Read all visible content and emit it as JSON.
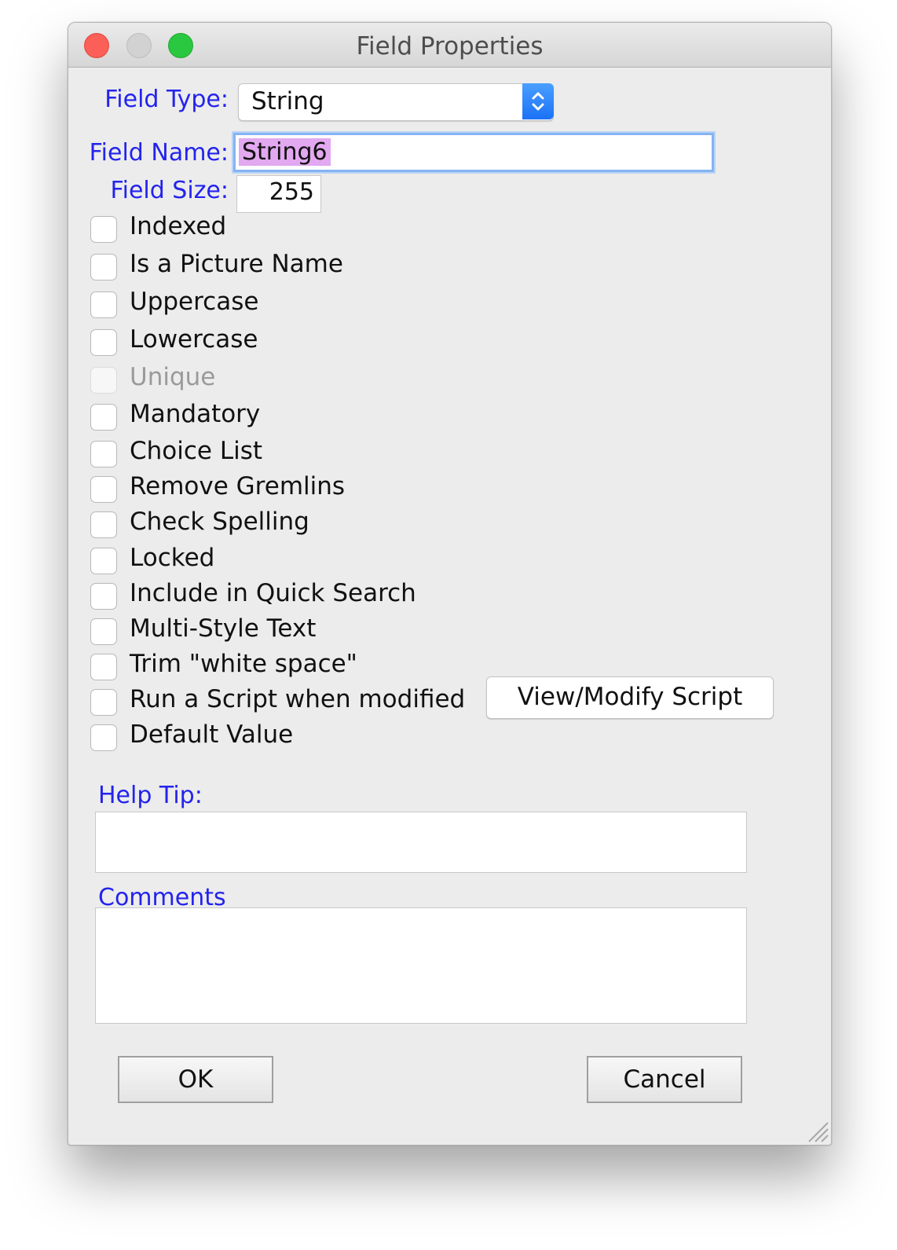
{
  "window": {
    "title": "Field Properties"
  },
  "field_type": {
    "label": "Field Type:",
    "value": "String"
  },
  "field_name": {
    "label": "Field Name:",
    "value": "String6"
  },
  "field_size": {
    "label": "Field Size:",
    "value": "255"
  },
  "options": [
    {
      "label": "Indexed",
      "checked": false,
      "enabled": true
    },
    {
      "label": "Is a Picture Name",
      "checked": false,
      "enabled": true
    },
    {
      "label": "Uppercase",
      "checked": false,
      "enabled": true
    },
    {
      "label": "Lowercase",
      "checked": false,
      "enabled": true
    },
    {
      "label": "Unique",
      "checked": false,
      "enabled": false
    },
    {
      "label": "Mandatory",
      "checked": false,
      "enabled": true
    },
    {
      "label": "Choice List",
      "checked": false,
      "enabled": true
    },
    {
      "label": "Remove Gremlins",
      "checked": false,
      "enabled": true
    },
    {
      "label": "Check Spelling",
      "checked": false,
      "enabled": true
    },
    {
      "label": "Locked",
      "checked": false,
      "enabled": true
    },
    {
      "label": "Include in Quick Search",
      "checked": false,
      "enabled": true
    },
    {
      "label": "Multi-Style Text",
      "checked": false,
      "enabled": true
    },
    {
      "label": "Trim \"white space\"",
      "checked": false,
      "enabled": true
    },
    {
      "label": "Run a Script when modified",
      "checked": false,
      "enabled": true
    },
    {
      "label": "Default Value",
      "checked": false,
      "enabled": true
    }
  ],
  "script_button": {
    "label": "View/Modify Script"
  },
  "help_tip": {
    "label": "Help Tip:",
    "value": ""
  },
  "comments": {
    "label": "Comments",
    "value": ""
  },
  "buttons": {
    "ok": "OK",
    "cancel": "Cancel"
  },
  "colors": {
    "label_blue": "#2323ee",
    "accent_blue": "#1b72f5",
    "selection": "#e2a8f0"
  }
}
